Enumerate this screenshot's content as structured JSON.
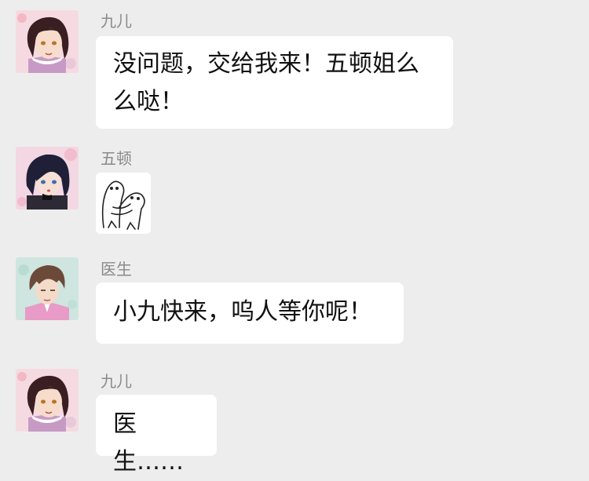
{
  "chat": {
    "messages": [
      {
        "sender": "九儿",
        "text": "没问题，交给我来！五顿姐么么哒！",
        "avatar_icon": "girl-dark-hair-avatar"
      },
      {
        "sender": "五顿",
        "text": "",
        "sticker_icon": "hugging-doodle-sticker",
        "avatar_icon": "boy-blue-eyes-avatar"
      },
      {
        "sender": "医生",
        "text": "小九快来，呜人等你呢！",
        "avatar_icon": "man-pink-shirt-avatar"
      },
      {
        "sender": "九儿",
        "text": "医生……",
        "avatar_icon": "girl-dark-hair-avatar"
      }
    ]
  },
  "colors": {
    "background": "#ededed",
    "bubble": "#ffffff",
    "sender_name": "#8a8a8a",
    "message_text": "#111111"
  }
}
